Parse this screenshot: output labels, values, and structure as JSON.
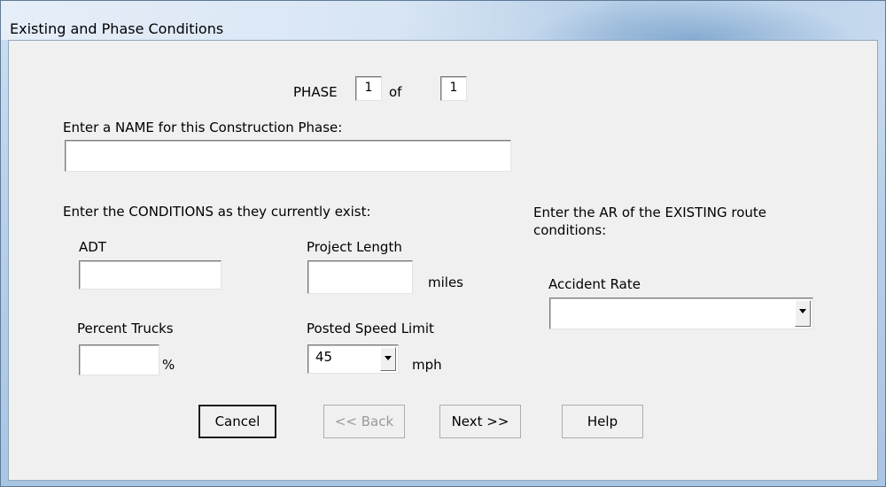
{
  "window": {
    "title": "Existing and Phase Conditions"
  },
  "phase": {
    "label": "PHASE",
    "current": "1",
    "of_label": "of",
    "total": "1"
  },
  "name_section": {
    "prompt": "Enter a NAME for this Construction Phase:",
    "value": ""
  },
  "conditions": {
    "prompt": "Enter the CONDITIONS as they currently exist:",
    "adt_label": "ADT",
    "adt_value": "",
    "project_length_label": "Project Length",
    "project_length_value": "",
    "project_length_unit": "miles",
    "percent_trucks_label": "Percent Trucks",
    "percent_trucks_value": "",
    "percent_trucks_unit": "%",
    "speed_limit_label": "Posted Speed Limit",
    "speed_limit_value": "45",
    "speed_limit_unit": "mph"
  },
  "accident": {
    "prompt": "Enter the AR of the EXISTING route conditions:",
    "rate_label": "Accident Rate",
    "rate_value": ""
  },
  "buttons": {
    "cancel": "Cancel",
    "back": "<< Back",
    "next": "Next >>",
    "help": "Help"
  }
}
